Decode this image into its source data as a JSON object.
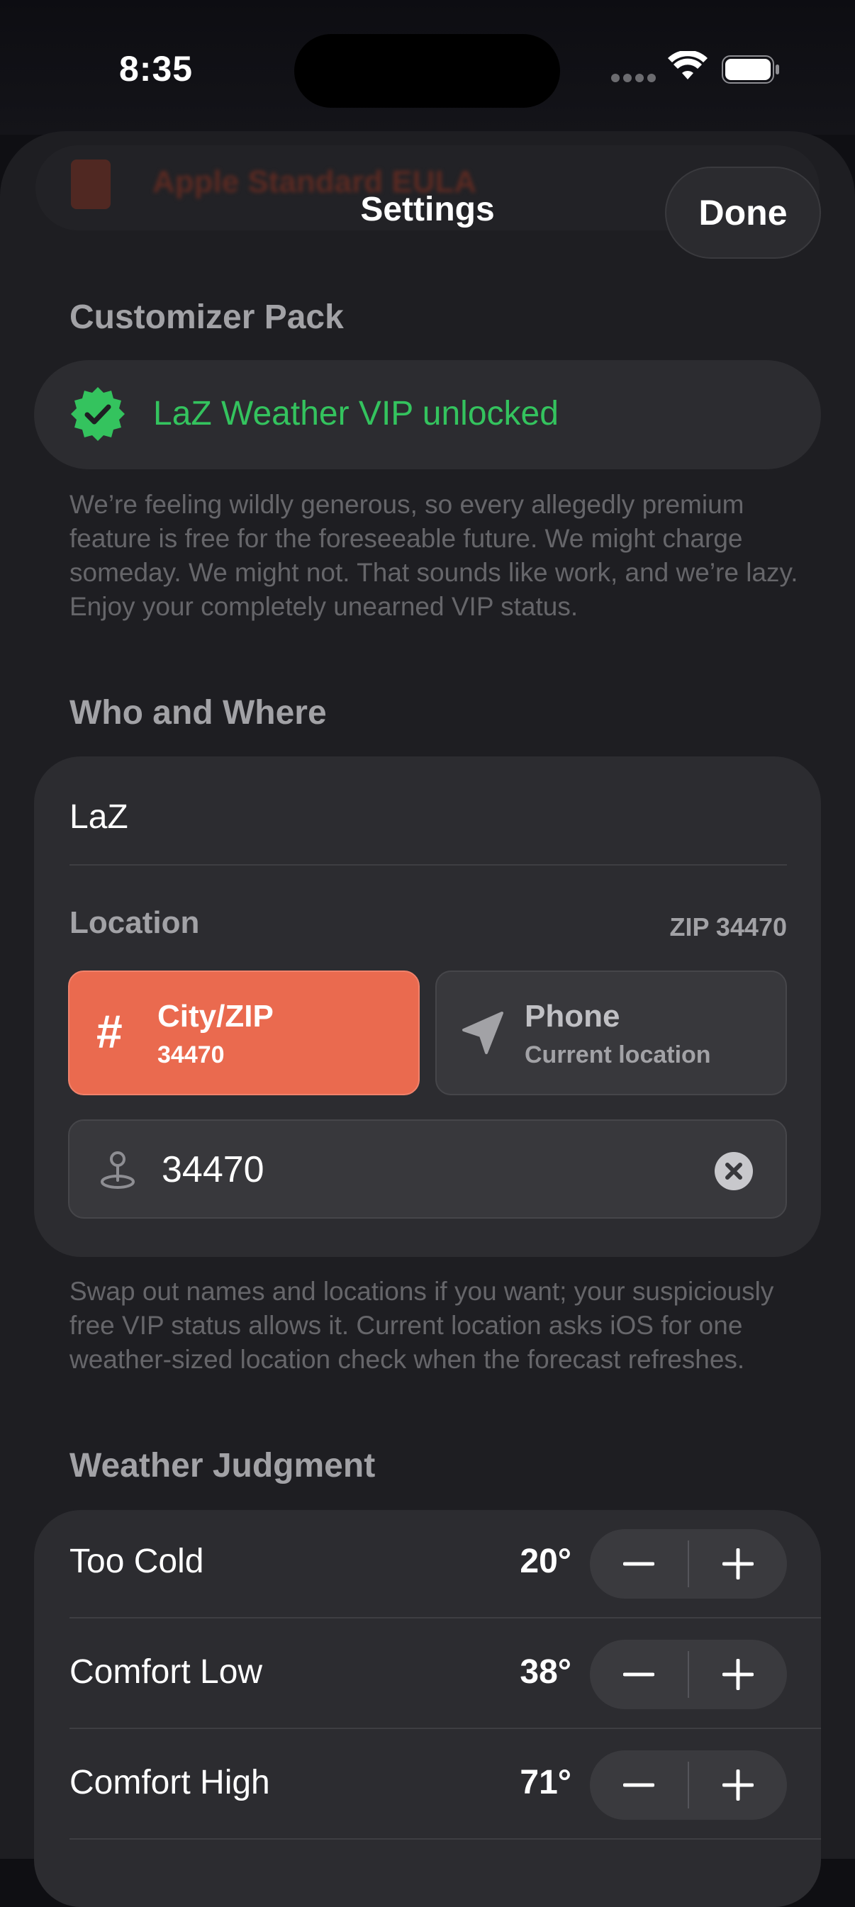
{
  "status_bar": {
    "time": "8:35"
  },
  "background_sheet": {
    "title": "Apple Standard EULA"
  },
  "nav": {
    "title": "Settings",
    "done_label": "Done"
  },
  "customizer": {
    "header": "Customizer Pack",
    "vip_text": "LaZ Weather VIP unlocked",
    "footnote": "We’re feeling wildly generous, so every allegedly premium feature is free for the foreseeable future. We might charge someday. We might not. That sounds like work, and we’re lazy. Enjoy your completely unearned VIP status."
  },
  "who_where": {
    "header": "Who and Where",
    "name_value": "LaZ",
    "location_label": "Location",
    "zip_label": "ZIP 34470",
    "modes": [
      {
        "icon": "hash-icon",
        "title": "City/ZIP",
        "subtitle": "34470",
        "selected": true
      },
      {
        "icon": "location-arrow-icon",
        "title": "Phone",
        "subtitle": "Current location",
        "selected": false
      }
    ],
    "zip_input_value": "34470",
    "footnote": "Swap out names and locations if you want; your suspiciously free VIP status allows it. Current location asks iOS for one weather-sized location check when the forecast refreshes."
  },
  "weather_judgment": {
    "header": "Weather Judgment",
    "rows": [
      {
        "label": "Too Cold",
        "value": "20°"
      },
      {
        "label": "Comfort Low",
        "value": "38°"
      },
      {
        "label": "Comfort High",
        "value": "71°"
      }
    ]
  },
  "colors": {
    "accent": "#ea6a4f",
    "vip_green": "#34c35e",
    "sheet_bg": "#1e1e22",
    "card_bg": "#2c2c30"
  }
}
